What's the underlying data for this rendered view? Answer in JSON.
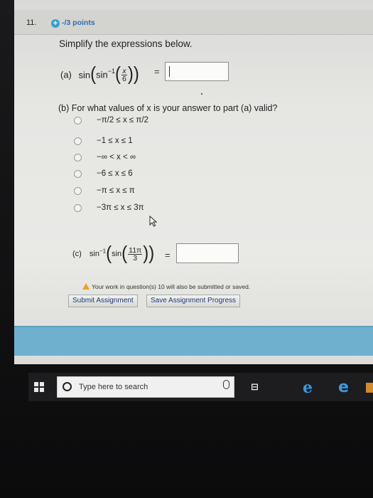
{
  "question": {
    "number": "11.",
    "points": "-/3 points",
    "prompt": "Simplify the expressions below."
  },
  "part_a": {
    "label": "(a)",
    "func_outer": "sin",
    "func_inner": "sin",
    "inv_exp": "−1",
    "frac_num": "x",
    "frac_den": "6",
    "equals": "="
  },
  "part_b": {
    "prompt": "(b) For what values of x is your answer to part (a) valid?",
    "options": [
      "−π/2 ≤ x ≤ π/2",
      "−1 ≤ x ≤ 1",
      "−∞ < x < ∞",
      "−6 ≤ x ≤ 6",
      "−π ≤ x ≤ π",
      "−3π ≤ x ≤ 3π"
    ]
  },
  "part_c": {
    "label": "(c)",
    "func_outer": "sin",
    "inv_exp": "−1",
    "func_inner": "sin",
    "frac_num": "11π",
    "frac_den": "3",
    "equals": "="
  },
  "footer": {
    "warning": "Your work in question(s) 10 will also be submitted or saved.",
    "submit_label": "Submit Assignment",
    "save_label": "Save Assignment Progress"
  },
  "taskbar": {
    "search_placeholder": "Type here to search"
  },
  "colors": {
    "points": "#2b6fb1",
    "band": "#6fb0cf",
    "taskbar": "#1d1d20"
  }
}
